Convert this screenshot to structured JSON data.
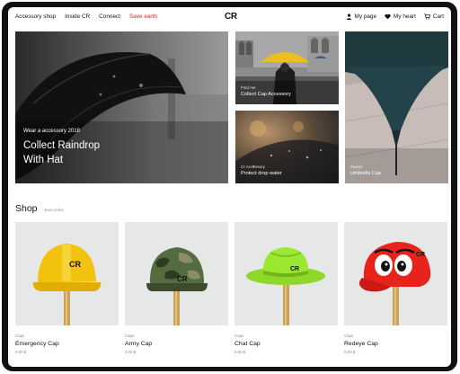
{
  "nav": {
    "left": [
      {
        "label": "Accessory shop"
      },
      {
        "label": "Inside CR"
      },
      {
        "label": "Connect"
      },
      {
        "label": "Save earth"
      }
    ],
    "logo": "CR",
    "right": [
      {
        "label": "My page",
        "icon": "user-icon"
      },
      {
        "label": "My heart",
        "icon": "heart-icon"
      },
      {
        "label": "Cart",
        "icon": "cart-icon"
      }
    ]
  },
  "hero": {
    "main": {
      "subtitle": "Wear a accessory 2018",
      "title": "Collect Raindrop With Hat"
    },
    "venice": {
      "subtitle": "Find me",
      "title": "Collect Cap Accessory"
    },
    "glass": {
      "subtitle": "Cr Accessory",
      "title": "Protect drop water"
    },
    "umbrella": {
      "subtitle": "Sweat",
      "title": "Umbrella Cap"
    }
  },
  "shop": {
    "title": "Shop",
    "subtitle": "Best seller",
    "products": [
      {
        "category": "Caps",
        "name": "Emergency Cap",
        "price": "0.00 $",
        "icon": "yellow-hard-hat"
      },
      {
        "category": "Caps",
        "name": "Army Cap",
        "price": "0.00 $",
        "icon": "camo-helmet"
      },
      {
        "category": "Caps",
        "name": "Chat Cap",
        "price": "0.00 $",
        "icon": "green-fedora"
      },
      {
        "category": "Caps",
        "name": "Redeye Cap",
        "price": "0.00 $",
        "icon": "red-eye-cap"
      }
    ]
  },
  "colors": {
    "accent": "#e02020"
  }
}
